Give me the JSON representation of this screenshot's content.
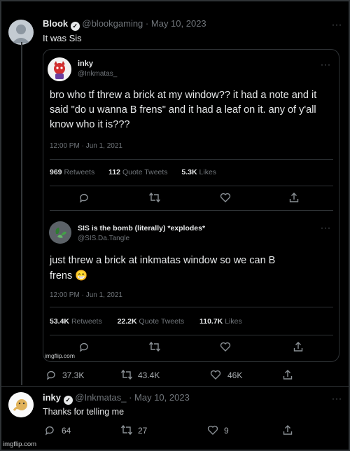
{
  "tweet1": {
    "name": "Blook",
    "handle": "@blookgaming",
    "sep": "·",
    "date": "May 10, 2023",
    "text": "It was Sis",
    "more": "···"
  },
  "quote1": {
    "name": "inky",
    "handle": "@Inkmatas_",
    "more": "···",
    "text": "bro who tf threw a brick at my window?? it had a note and it said \"do u wanna B frens\" and it had a leaf on it. any of y'all know who it is???",
    "timestamp": "12:00 PM · Jun 1, 2021",
    "retweets_num": "969",
    "retweets_label": "Retweets",
    "quotes_num": "112",
    "quotes_label": "Quote Tweets",
    "likes_num": "5.3K",
    "likes_label": "Likes"
  },
  "quote2": {
    "name": "SIS is the bomb (literally) *explodes*",
    "handle": "@SIS.Da.Tangle",
    "more": "···",
    "text": "just threw a brick at inkmatas window so we can B frens 😁",
    "timestamp": "12:00 PM · Jun 1, 2021",
    "retweets_num": "53.4K",
    "retweets_label": "Retweets",
    "quotes_num": "22.2K",
    "quotes_label": "Quote Tweets",
    "likes_num": "110.7K",
    "likes_label": "Likes",
    "watermark": "imgflip.com"
  },
  "tweet1_actions": {
    "replies": "37.3K",
    "retweets": "43.4K",
    "likes": "46K"
  },
  "tweet2": {
    "name": "inky",
    "handle": "@Inkmatas_",
    "sep": "·",
    "date": "May 10, 2023",
    "text": "Thanks for telling me",
    "more": "···",
    "replies": "64",
    "retweets": "27",
    "likes": "9"
  },
  "footer": {
    "watermark": "imgflip.com"
  },
  "colors": {
    "background": "#000000",
    "muted": "#71767b",
    "divider": "#2f3336"
  }
}
